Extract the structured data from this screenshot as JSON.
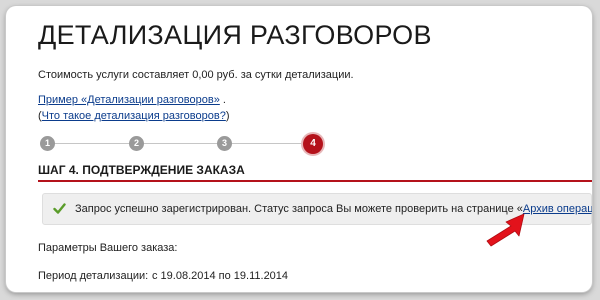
{
  "page": {
    "title": "ДЕТАЛИЗАЦИЯ РАЗГОВОРОВ",
    "cost_text": "Стоимость услуги составляет 0,00 руб. за сутки детализации."
  },
  "links": {
    "example_label": "Пример «Детализации разговоров»",
    "example_suffix": ".",
    "what_is_prefix": "(",
    "what_is_label": "Что такое детализация разговоров?",
    "what_is_suffix": ")"
  },
  "steps": {
    "items": [
      "1",
      "2",
      "3",
      "4"
    ],
    "active": "4",
    "current_title": "ШАГ 4. ПОДТВЕРЖДЕНИЕ ЗАКАЗА"
  },
  "success": {
    "icon": "check-icon",
    "message_prefix": "Запрос успешно зарегистрирован. Статус запроса Вы можете проверить на странице «",
    "archive_link": "Архив операций",
    "message_suffix": "»."
  },
  "annotation": {
    "icon": "red-arrow-icon",
    "color": "#e3121b"
  },
  "order": {
    "params_label": "Параметры Вашего заказа:",
    "period_label": "Период детализации:",
    "period_value": "с 19.08.2014 по 19.11.2014"
  },
  "colors": {
    "accent": "#b4121b",
    "link": "#0b3c8c",
    "step_inactive": "#9a9a9a",
    "success_bg": "#efefef",
    "check": "#5a9c2a"
  }
}
